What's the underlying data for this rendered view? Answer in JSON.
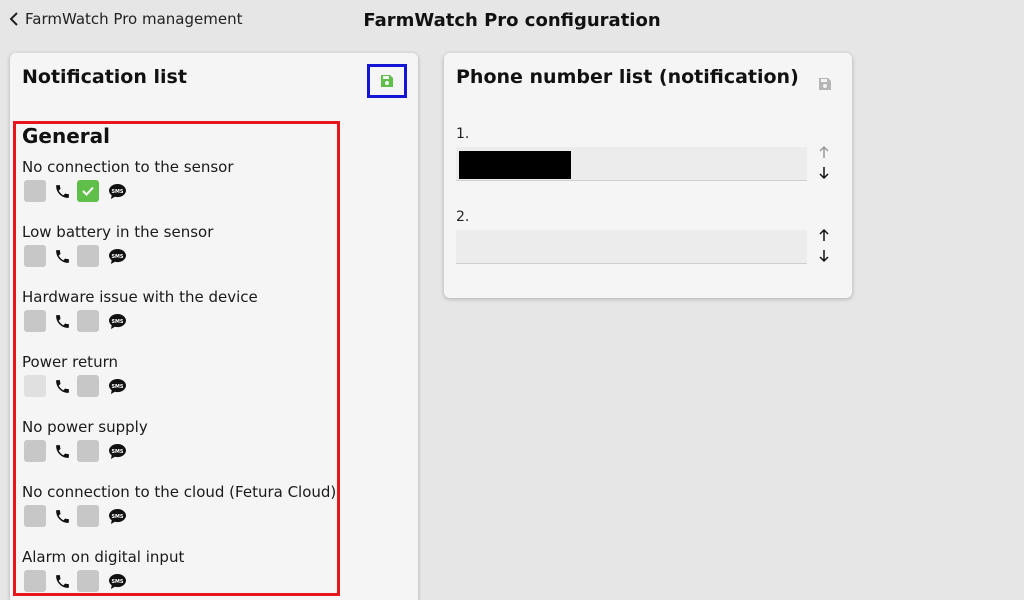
{
  "header": {
    "back_label": "FarmWatch Pro management",
    "title": "FarmWatch Pro configuration"
  },
  "notification_panel": {
    "title": "Notification list",
    "section_heading": "General",
    "items": [
      {
        "label": "No connection to the sensor",
        "call_checked": false,
        "sms_checked": true
      },
      {
        "label": "Low battery in the sensor",
        "call_checked": false,
        "sms_checked": false
      },
      {
        "label": "Hardware issue with the device",
        "call_checked": false,
        "sms_checked": false
      },
      {
        "label": "Power return",
        "call_checked": false,
        "sms_checked": false
      },
      {
        "label": "No power supply",
        "call_checked": false,
        "sms_checked": false
      },
      {
        "label": "No connection to the cloud (Fetura Cloud)",
        "call_checked": false,
        "sms_checked": false
      },
      {
        "label": "Alarm on digital input",
        "call_checked": false,
        "sms_checked": false
      }
    ]
  },
  "phone_panel": {
    "title": "Phone number list (notification)",
    "entries": [
      {
        "index": "1.",
        "value": "",
        "redacted": true
      },
      {
        "index": "2.",
        "value": "",
        "redacted": false
      }
    ]
  },
  "colors": {
    "save_active": "#5fbf4a",
    "save_disabled": "#b5b5b5",
    "checkbox_checked": "#5fbf4a",
    "highlight_red": "#e8161c",
    "highlight_blue": "#1515d6"
  }
}
